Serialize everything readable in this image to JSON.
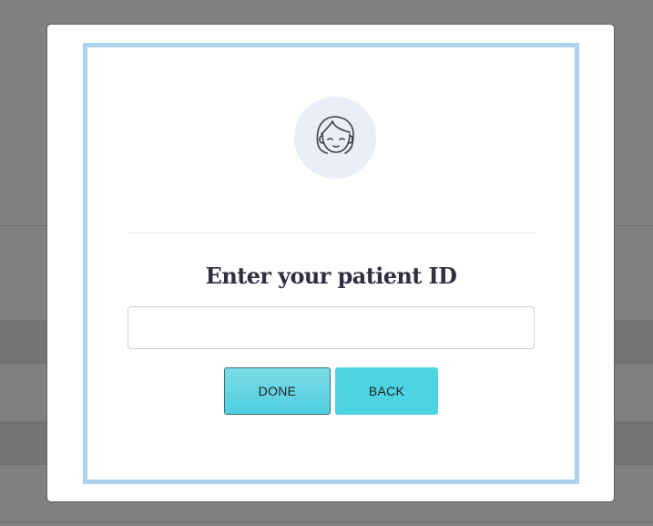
{
  "dialog": {
    "title": "Enter your patient ID",
    "input_value": "",
    "input_placeholder": "",
    "done_label": "DONE",
    "back_label": "BACK"
  },
  "colors": {
    "frame_border": "#acd4f0",
    "button_accent": "#4dd4e3",
    "avatar_bg": "#eaeff7",
    "title_text": "#2f3140"
  },
  "icons": {
    "avatar": "woman-face-icon"
  }
}
